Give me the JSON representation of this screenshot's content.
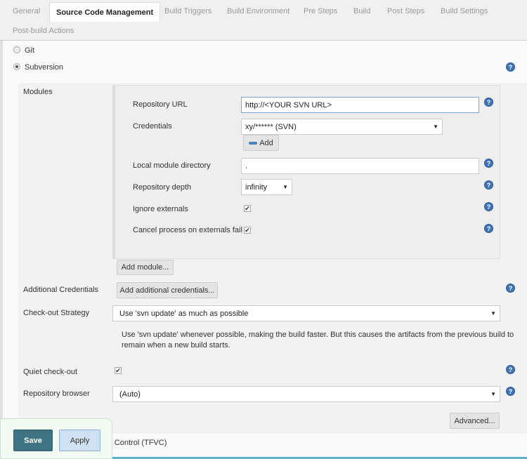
{
  "tabs": [
    "General",
    "Source Code Management",
    "Build Triggers",
    "Build Environment",
    "Pre Steps",
    "Build",
    "Post Steps",
    "Build Settings",
    "Post-build Actions"
  ],
  "scm": {
    "git": "Git",
    "subversion": "Subversion",
    "tfvc": "Team Foundation Version Control (TFVC)"
  },
  "modules": {
    "label": "Modules",
    "repo_url_label": "Repository URL",
    "repo_url_value": "http://<YOUR SVN URL>",
    "credentials_label": "Credentials",
    "credentials_value": "xy/****** (SVN)",
    "add_label": "Add",
    "local_dir_label": "Local module directory",
    "local_dir_value": ".",
    "depth_label": "Repository depth",
    "depth_value": "infinity",
    "ignore_externals_label": "Ignore externals",
    "cancel_externals_label": "Cancel process on externals fail",
    "add_module": "Add module..."
  },
  "additional_credentials": {
    "label": "Additional Credentials",
    "button": "Add additional credentials..."
  },
  "checkout": {
    "label": "Check-out Strategy",
    "value": "Use 'svn update' as much as possible",
    "desc_line1": "Use 'svn update' whenever possible, making the build faster. But this causes the artifacts from the previous build to",
    "desc_line2": "remain when a new build starts."
  },
  "quiet": {
    "label": "Quiet check-out"
  },
  "browser": {
    "label": "Repository browser",
    "value": "(Auto)"
  },
  "advanced": "Advanced...",
  "footer": {
    "save": "Save",
    "apply": "Apply"
  },
  "help_glyph": "?",
  "checkmark": "✔",
  "arrow": "▼"
}
